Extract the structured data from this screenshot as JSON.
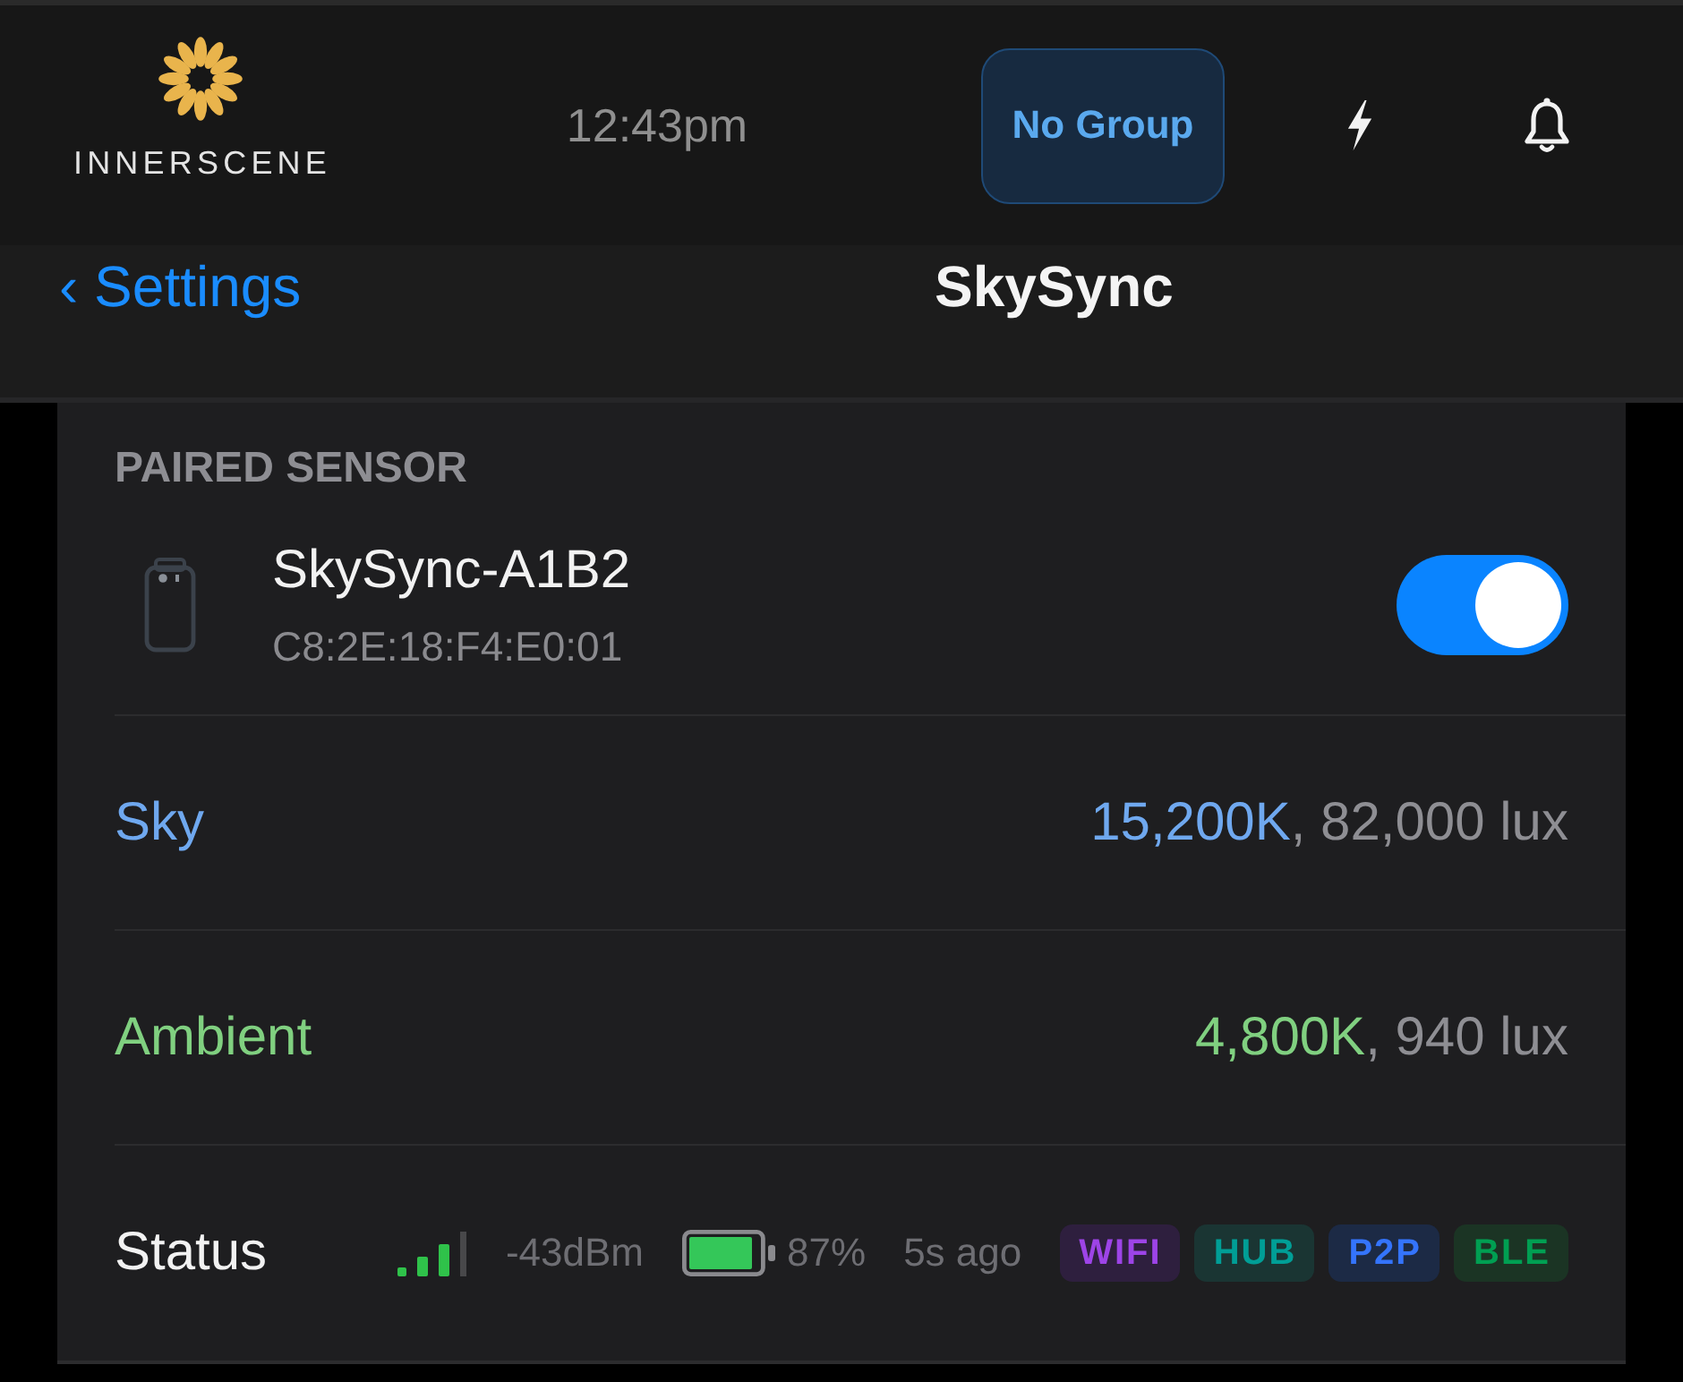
{
  "header": {
    "logo": {
      "text": "INNERSCENE"
    },
    "time": "12:43pm",
    "group_button": {
      "label": "No Group"
    }
  },
  "nav": {
    "back": "‹ Settings",
    "title": "SkySync"
  },
  "paired_sensor": {
    "heading": "PAIRED SENSOR",
    "name": "SkySync-A1B2",
    "address": "C8:2E:18:F4:E0:01",
    "on": true
  },
  "readings": [
    {
      "label": "Sky",
      "color": "#6fa8ef",
      "kelvin": "15,200K",
      "lux": ", 82,000 lux"
    },
    {
      "label": "Ambient",
      "color": "#80d080",
      "kelvin": "4,800K",
      "lux": ", 940 lux"
    }
  ],
  "status": {
    "label": "Status",
    "signal": "-43dBm",
    "battery": "87%",
    "last_seen": "5s ago",
    "links": [
      {
        "label": "WIFI",
        "color": "#2e1f3e"
      },
      {
        "label": "HUB",
        "color": "#1a3533"
      },
      {
        "label": "P2P",
        "color": "#1c2a45"
      },
      {
        "label": "BLE",
        "color": "#1b3424"
      }
    ]
  }
}
